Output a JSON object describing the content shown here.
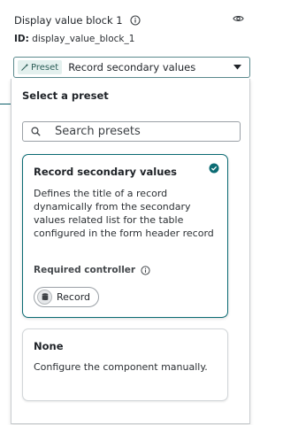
{
  "header": {
    "title": "Display value block 1",
    "id_label": "ID:",
    "id_value": "display_value_block_1"
  },
  "select": {
    "preset_chip": "Preset",
    "value": "Record secondary values"
  },
  "dropdown": {
    "title": "Select a preset",
    "search_placeholder": "Search presets",
    "cards": [
      {
        "title": "Record secondary values",
        "description": "Defines the title of a record dynamically from the secondary values related list for the table configured in the form header record",
        "required_label": "Required controller",
        "controller_chip": "Record",
        "selected": true
      },
      {
        "title": "None",
        "description": "Configure the component manually.",
        "selected": false
      }
    ]
  },
  "colors": {
    "accent": "#0b6b73",
    "chip_bg": "#e3f0ee"
  },
  "icons": [
    "info-icon",
    "eye-icon",
    "wand-icon",
    "caret-down-icon",
    "search-icon",
    "check-circle-icon",
    "database-icon"
  ]
}
